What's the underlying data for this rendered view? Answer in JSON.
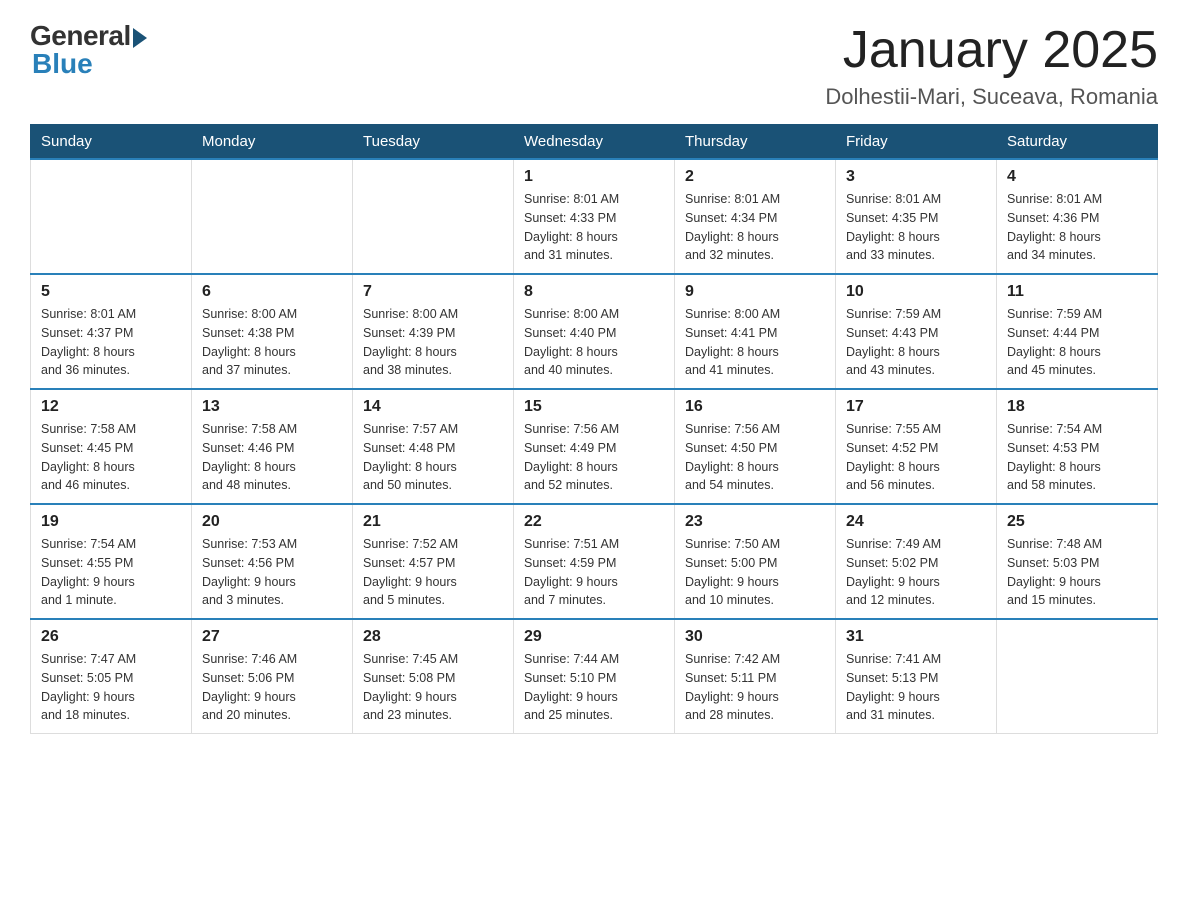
{
  "logo": {
    "general": "General",
    "blue": "Blue"
  },
  "title": "January 2025",
  "subtitle": "Dolhestii-Mari, Suceava, Romania",
  "days_of_week": [
    "Sunday",
    "Monday",
    "Tuesday",
    "Wednesday",
    "Thursday",
    "Friday",
    "Saturday"
  ],
  "weeks": [
    [
      {
        "day": "",
        "info": ""
      },
      {
        "day": "",
        "info": ""
      },
      {
        "day": "",
        "info": ""
      },
      {
        "day": "1",
        "info": "Sunrise: 8:01 AM\nSunset: 4:33 PM\nDaylight: 8 hours\nand 31 minutes."
      },
      {
        "day": "2",
        "info": "Sunrise: 8:01 AM\nSunset: 4:34 PM\nDaylight: 8 hours\nand 32 minutes."
      },
      {
        "day": "3",
        "info": "Sunrise: 8:01 AM\nSunset: 4:35 PM\nDaylight: 8 hours\nand 33 minutes."
      },
      {
        "day": "4",
        "info": "Sunrise: 8:01 AM\nSunset: 4:36 PM\nDaylight: 8 hours\nand 34 minutes."
      }
    ],
    [
      {
        "day": "5",
        "info": "Sunrise: 8:01 AM\nSunset: 4:37 PM\nDaylight: 8 hours\nand 36 minutes."
      },
      {
        "day": "6",
        "info": "Sunrise: 8:00 AM\nSunset: 4:38 PM\nDaylight: 8 hours\nand 37 minutes."
      },
      {
        "day": "7",
        "info": "Sunrise: 8:00 AM\nSunset: 4:39 PM\nDaylight: 8 hours\nand 38 minutes."
      },
      {
        "day": "8",
        "info": "Sunrise: 8:00 AM\nSunset: 4:40 PM\nDaylight: 8 hours\nand 40 minutes."
      },
      {
        "day": "9",
        "info": "Sunrise: 8:00 AM\nSunset: 4:41 PM\nDaylight: 8 hours\nand 41 minutes."
      },
      {
        "day": "10",
        "info": "Sunrise: 7:59 AM\nSunset: 4:43 PM\nDaylight: 8 hours\nand 43 minutes."
      },
      {
        "day": "11",
        "info": "Sunrise: 7:59 AM\nSunset: 4:44 PM\nDaylight: 8 hours\nand 45 minutes."
      }
    ],
    [
      {
        "day": "12",
        "info": "Sunrise: 7:58 AM\nSunset: 4:45 PM\nDaylight: 8 hours\nand 46 minutes."
      },
      {
        "day": "13",
        "info": "Sunrise: 7:58 AM\nSunset: 4:46 PM\nDaylight: 8 hours\nand 48 minutes."
      },
      {
        "day": "14",
        "info": "Sunrise: 7:57 AM\nSunset: 4:48 PM\nDaylight: 8 hours\nand 50 minutes."
      },
      {
        "day": "15",
        "info": "Sunrise: 7:56 AM\nSunset: 4:49 PM\nDaylight: 8 hours\nand 52 minutes."
      },
      {
        "day": "16",
        "info": "Sunrise: 7:56 AM\nSunset: 4:50 PM\nDaylight: 8 hours\nand 54 minutes."
      },
      {
        "day": "17",
        "info": "Sunrise: 7:55 AM\nSunset: 4:52 PM\nDaylight: 8 hours\nand 56 minutes."
      },
      {
        "day": "18",
        "info": "Sunrise: 7:54 AM\nSunset: 4:53 PM\nDaylight: 8 hours\nand 58 minutes."
      }
    ],
    [
      {
        "day": "19",
        "info": "Sunrise: 7:54 AM\nSunset: 4:55 PM\nDaylight: 9 hours\nand 1 minute."
      },
      {
        "day": "20",
        "info": "Sunrise: 7:53 AM\nSunset: 4:56 PM\nDaylight: 9 hours\nand 3 minutes."
      },
      {
        "day": "21",
        "info": "Sunrise: 7:52 AM\nSunset: 4:57 PM\nDaylight: 9 hours\nand 5 minutes."
      },
      {
        "day": "22",
        "info": "Sunrise: 7:51 AM\nSunset: 4:59 PM\nDaylight: 9 hours\nand 7 minutes."
      },
      {
        "day": "23",
        "info": "Sunrise: 7:50 AM\nSunset: 5:00 PM\nDaylight: 9 hours\nand 10 minutes."
      },
      {
        "day": "24",
        "info": "Sunrise: 7:49 AM\nSunset: 5:02 PM\nDaylight: 9 hours\nand 12 minutes."
      },
      {
        "day": "25",
        "info": "Sunrise: 7:48 AM\nSunset: 5:03 PM\nDaylight: 9 hours\nand 15 minutes."
      }
    ],
    [
      {
        "day": "26",
        "info": "Sunrise: 7:47 AM\nSunset: 5:05 PM\nDaylight: 9 hours\nand 18 minutes."
      },
      {
        "day": "27",
        "info": "Sunrise: 7:46 AM\nSunset: 5:06 PM\nDaylight: 9 hours\nand 20 minutes."
      },
      {
        "day": "28",
        "info": "Sunrise: 7:45 AM\nSunset: 5:08 PM\nDaylight: 9 hours\nand 23 minutes."
      },
      {
        "day": "29",
        "info": "Sunrise: 7:44 AM\nSunset: 5:10 PM\nDaylight: 9 hours\nand 25 minutes."
      },
      {
        "day": "30",
        "info": "Sunrise: 7:42 AM\nSunset: 5:11 PM\nDaylight: 9 hours\nand 28 minutes."
      },
      {
        "day": "31",
        "info": "Sunrise: 7:41 AM\nSunset: 5:13 PM\nDaylight: 9 hours\nand 31 minutes."
      },
      {
        "day": "",
        "info": ""
      }
    ]
  ]
}
